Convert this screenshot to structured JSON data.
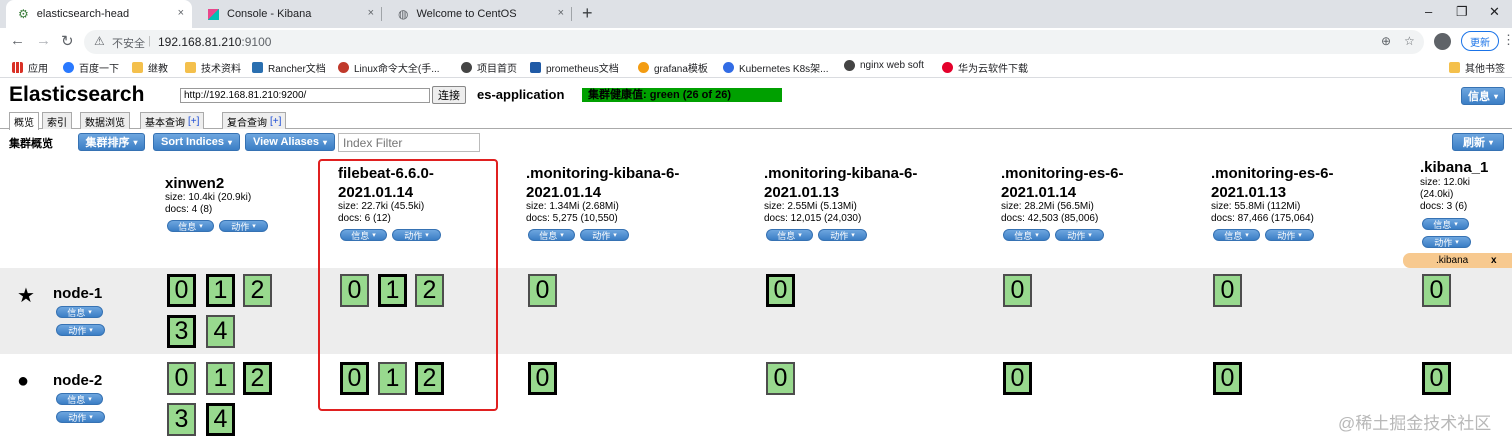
{
  "browser": {
    "tabs": [
      {
        "title": "elasticsearch-head",
        "active": true
      },
      {
        "title": "Console - Kibana",
        "active": false
      },
      {
        "title": "Welcome to CentOS",
        "active": false
      }
    ],
    "tab_close": "×",
    "new_tab": "+",
    "window_controls": {
      "minimize": "–",
      "restore": "❐",
      "close": "✕"
    },
    "nav": {
      "back": "←",
      "forward": "→",
      "reload": "↻"
    },
    "address": {
      "insecure_label": "不安全",
      "separator": "|",
      "host": "192.168.81.210",
      "port": ":9100"
    },
    "update_label": "更新",
    "menu": "⋮",
    "bookmarks": [
      {
        "label": "应用",
        "color": "#d93025"
      },
      {
        "label": "百度一下",
        "color": "#2979ff"
      },
      {
        "label": "继教",
        "color": "#f4c04c"
      },
      {
        "label": "技术资料",
        "color": "#f4c04c"
      },
      {
        "label": "Rancher文档",
        "color": "#2a6fb0"
      },
      {
        "label": "Linux命令大全(手...",
        "color": "#c0392b"
      },
      {
        "label": "项目首页",
        "color": "#444444"
      },
      {
        "label": "prometheus文档",
        "color": "#1f5aa6"
      },
      {
        "label": "grafana模板",
        "color": "#f39c12"
      },
      {
        "label": "Kubernetes K8s架...",
        "color": "#326ce5"
      },
      {
        "label": "nginx web soft",
        "color": "#444444"
      },
      {
        "label": "华为云软件下载",
        "color": "#e4002b"
      }
    ],
    "other_bookmarks": "其他书签"
  },
  "es": {
    "title": "Elasticsearch",
    "connect_url": "http://192.168.81.210:9200/",
    "connect_label": "连接",
    "cluster_name": "es-application",
    "health": "集群健康值: green (26 of 26)",
    "info_label": "信息",
    "tabs": [
      "概览",
      "索引",
      "数据浏览",
      "基本查询",
      "复合查询"
    ],
    "tab_plus": "[+]",
    "overview_label": "集群概览",
    "sort_cluster": "集群排序",
    "sort_indices": "Sort Indices",
    "view_aliases": "View Aliases",
    "index_filter_placeholder": "Index Filter",
    "refresh": "刷新",
    "pill_info": "信息",
    "pill_action": "动作",
    "caret": "▾",
    "alias_tag": ".kibana",
    "alias_close": "x",
    "indices": [
      {
        "name1": "xinwen2",
        "name2": "",
        "size": "size: 10.4ki (20.9ki)",
        "docs": "docs: 4 (8)"
      },
      {
        "name1": "filebeat-6.6.0-",
        "name2": "2021.01.14",
        "size": "size: 22.7ki (45.5ki)",
        "docs": "docs: 6 (12)"
      },
      {
        "name1": ".monitoring-kibana-6-",
        "name2": "2021.01.14",
        "size": "size: 1.34Mi (2.68Mi)",
        "docs": "docs: 5,275 (10,550)"
      },
      {
        "name1": ".monitoring-kibana-6-",
        "name2": "2021.01.13",
        "size": "size: 2.55Mi (5.13Mi)",
        "docs": "docs: 12,015 (24,030)"
      },
      {
        "name1": ".monitoring-es-6-",
        "name2": "2021.01.14",
        "size": "size: 28.2Mi (56.5Mi)",
        "docs": "docs: 42,503 (85,006)"
      },
      {
        "name1": ".monitoring-es-6-",
        "name2": "2021.01.13",
        "size": "size: 55.8Mi (112Mi)",
        "docs": "docs: 87,466 (175,064)"
      },
      {
        "name1": ".kibana_1",
        "name2": "",
        "size": "size: 12.0ki",
        "size2": "(24.0ki)",
        "docs": "docs: 3 (6)"
      }
    ],
    "nodes": [
      {
        "name": "node-1",
        "icon": "★",
        "master": true
      },
      {
        "name": "node-2",
        "icon": "●",
        "master": false
      }
    ],
    "shards": {
      "node1": {
        "xinwen2": [
          "0",
          "1",
          "2",
          "3",
          "4"
        ],
        "filebeat": [
          "0",
          "1",
          "2"
        ],
        "mk14": "0",
        "mk13": "0",
        "me14": "0",
        "me13": "0",
        "kib": "0"
      },
      "node2": {
        "xinwen2": [
          "0",
          "1",
          "2",
          "3",
          "4"
        ],
        "filebeat": [
          "0",
          "1",
          "2"
        ],
        "mk14": "0",
        "mk13": "0",
        "me14": "0",
        "me13": "0",
        "kib": "0"
      }
    }
  },
  "watermark": "@稀土掘金技术社区"
}
